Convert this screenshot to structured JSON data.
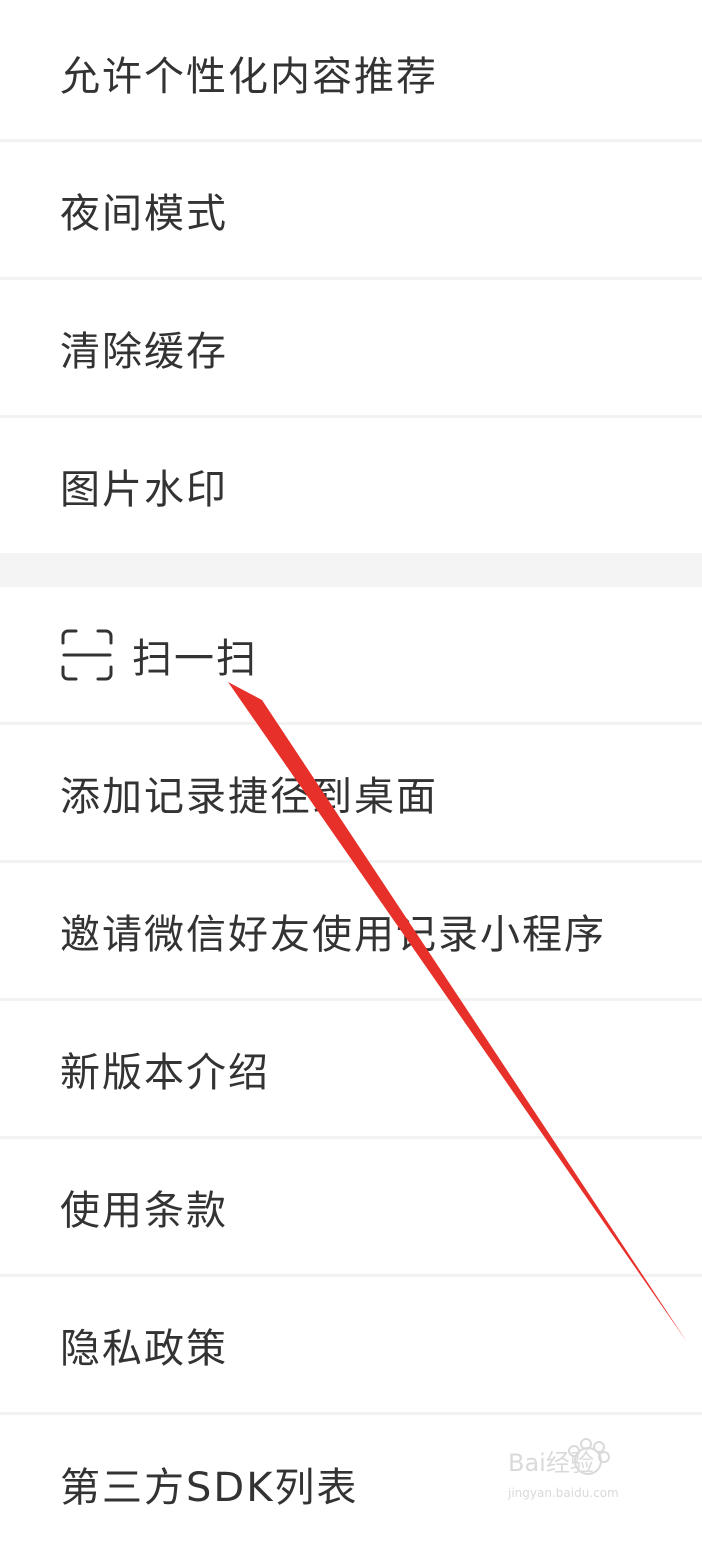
{
  "menu": {
    "items": [
      {
        "label": "允许个性化内容推荐"
      },
      {
        "label": "夜间模式"
      },
      {
        "label": "清除缓存"
      },
      {
        "label": "图片水印"
      },
      {
        "label": "扫一扫",
        "icon": "scan-icon"
      },
      {
        "label": "添加记录捷径到桌面"
      },
      {
        "label": "邀请微信好友使用记录小程序"
      },
      {
        "label": "新版本介绍"
      },
      {
        "label": "使用条款"
      },
      {
        "label": "隐私政策"
      },
      {
        "label": "第三方SDK列表"
      }
    ]
  },
  "colors": {
    "text": "#333333",
    "divider": "#f2f2f2",
    "section_gap": "#f3f4f3",
    "annotation_arrow": "#e8302a"
  },
  "watermark": {
    "line1": "Bai经验",
    "line2": "jingyan.baidu.com"
  }
}
